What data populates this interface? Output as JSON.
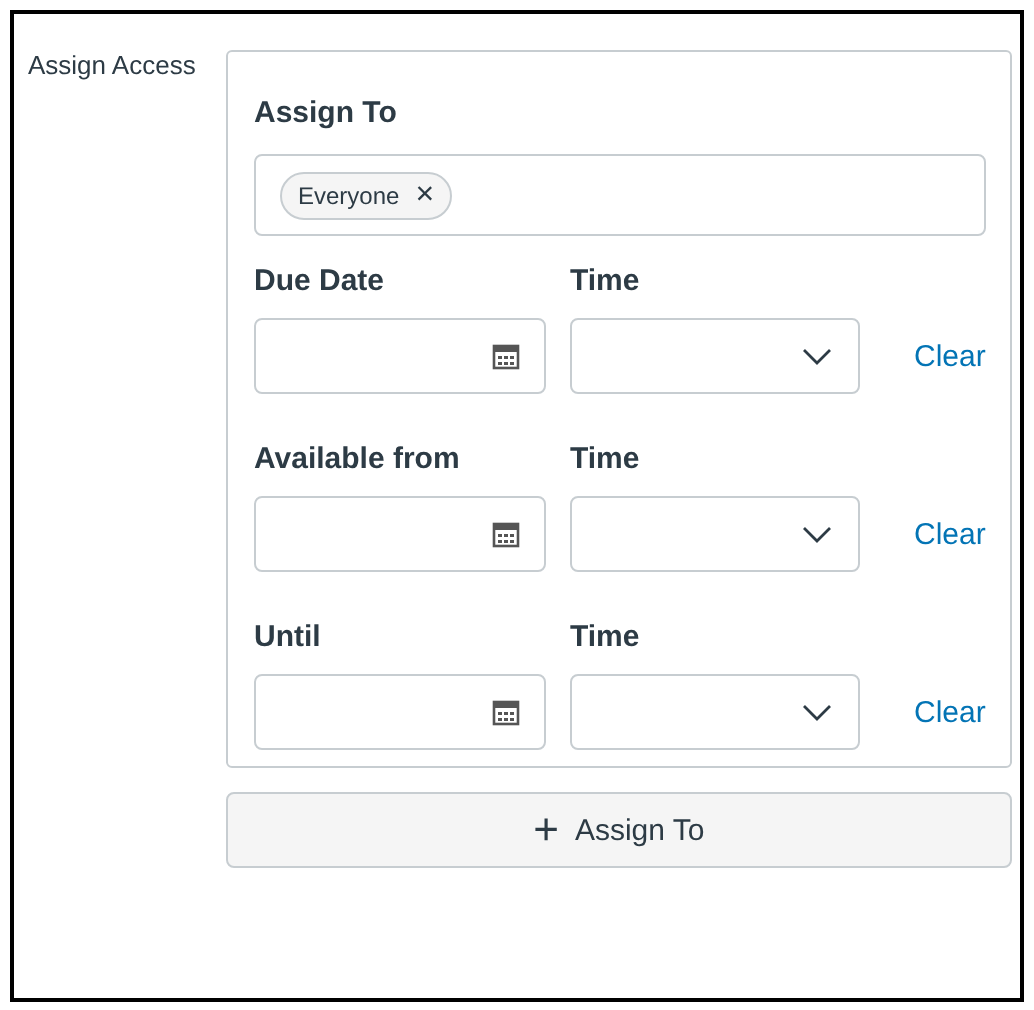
{
  "section_label": "Assign Access",
  "assign_to": {
    "label": "Assign To",
    "chips": [
      {
        "text": "Everyone",
        "remove": "×"
      }
    ]
  },
  "rows": [
    {
      "date_label": "Due Date",
      "time_label": "Time",
      "clear": "Clear"
    },
    {
      "date_label": "Available from",
      "time_label": "Time",
      "clear": "Clear"
    },
    {
      "date_label": "Until",
      "time_label": "Time",
      "clear": "Clear"
    }
  ],
  "add_button": {
    "icon": "+",
    "label": "Assign To"
  }
}
